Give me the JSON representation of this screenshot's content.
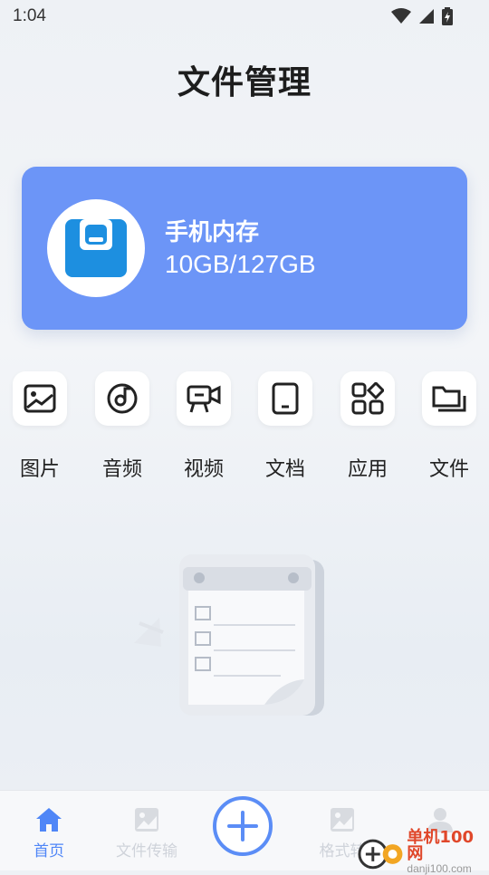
{
  "status_bar": {
    "time": "1:04",
    "icons": [
      "wifi-icon",
      "signal-icon",
      "battery-icon"
    ]
  },
  "header": {
    "title": "文件管理"
  },
  "storage": {
    "name": "手机内存",
    "usage": "10GB/127GB",
    "icon": "floppy-disk-icon",
    "accent": "#6c95f7"
  },
  "categories": [
    {
      "label": "图片",
      "icon": "image-icon"
    },
    {
      "label": "音频",
      "icon": "music-disc-icon"
    },
    {
      "label": "视频",
      "icon": "video-camera-icon"
    },
    {
      "label": "文档",
      "icon": "document-icon"
    },
    {
      "label": "应用",
      "icon": "apps-icon"
    },
    {
      "label": "文件",
      "icon": "folder-icon"
    }
  ],
  "empty_state": {
    "icon": "empty-notepad-illustration"
  },
  "tabbar": {
    "tabs": [
      {
        "label": "首页",
        "icon": "home-icon",
        "active": true
      },
      {
        "label": "文件传输",
        "icon": "transfer-image-icon",
        "active": false
      },
      {
        "label": "",
        "icon": "add-icon",
        "active": false
      },
      {
        "label": "格式转",
        "icon": "format-convert-icon",
        "active": false
      },
      {
        "label": "",
        "icon": "user-icon",
        "active": false
      }
    ],
    "active_color": "#4f86f7"
  },
  "watermark": {
    "text": "单机100网",
    "url": "danji100.com"
  }
}
